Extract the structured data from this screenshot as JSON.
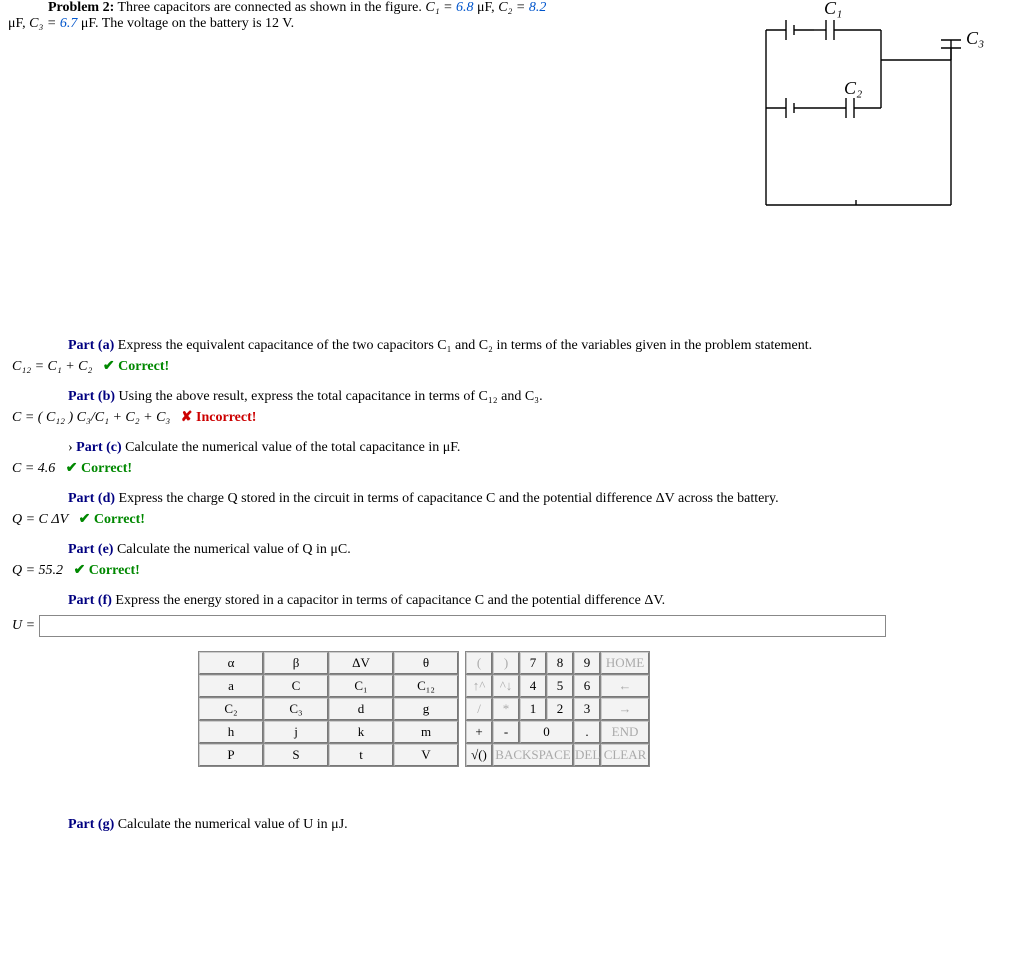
{
  "problem": {
    "label": "Problem 2:",
    "text_prefix": "Three capacitors are connected as shown in the figure. ",
    "c1_sym": "C₁ = ",
    "c1_val": "6.8",
    "c1_unit": " μF, ",
    "c2_sym": "C₂ = ",
    "c2_val": "8.2",
    "line2_prefix": "μF, ",
    "c3_sym": "C₃ = ",
    "c3_val": "6.7",
    "c3_unit": " μF. The voltage on the battery is 12 V."
  },
  "circuit": {
    "c1": "C₁",
    "c2": "C₂",
    "c3": "C₃"
  },
  "parts": {
    "a": {
      "label": "Part (a)",
      "text": "Express the equivalent capacitance of the two capacitors C₁ and C₂ in terms of the variables given in the problem statement.",
      "answer": "C₁₂ = C₁ + C₂",
      "status": "✔ Correct!"
    },
    "b": {
      "label": "Part (b)",
      "text": "Using the above result, express the total capacitance in terms of C₁₂ and C₃.",
      "answer": "C = ( C₁₂ ) C₃/C₁ + C₂ + C₃",
      "status": "✘ Incorrect!"
    },
    "c": {
      "label": "Part (c)",
      "marker": "›",
      "text": "Calculate the numerical value of the total capacitance in μF.",
      "answer": "C = 4.6",
      "status": "✔ Correct!"
    },
    "d": {
      "label": "Part (d)",
      "text": "Express the charge Q stored in the circuit in terms of capacitance C and the potential difference ΔV across the battery.",
      "answer": "Q = C ΔV",
      "status": "✔ Correct!"
    },
    "e": {
      "label": "Part (e)",
      "text": "Calculate the numerical value of Q in μC.",
      "answer": "Q = 55.2",
      "status": "✔ Correct!"
    },
    "f": {
      "label": "Part (f)",
      "text": "Express the energy stored in a capacitor in terms of capacitance C and the potential difference ΔV.",
      "input_label": "U ="
    },
    "g": {
      "label": "Part (g)",
      "text": "Calculate the numerical value of U in μJ."
    }
  },
  "keypad": {
    "vars": [
      [
        "α",
        "β",
        "ΔV",
        "θ"
      ],
      [
        "a",
        "C",
        "C₁",
        "C₁₂"
      ],
      [
        "C₂",
        "C₃",
        "d",
        "g"
      ],
      [
        "h",
        "j",
        "k",
        "m"
      ],
      [
        "P",
        "S",
        "t",
        "V"
      ]
    ],
    "nums_rows": [
      [
        "(",
        ")",
        "7",
        "8",
        "9",
        "HOME"
      ],
      [
        "↑^",
        "^↓",
        "4",
        "5",
        "6",
        "←"
      ],
      [
        "/",
        "*",
        "1",
        "2",
        "3",
        "→"
      ],
      [
        "+",
        "-",
        "0",
        "0",
        ".",
        "END"
      ]
    ],
    "bottom": {
      "sqrt": "√()",
      "backspace": "BACKSPACE",
      "del": "DEL",
      "clear": "CLEAR"
    }
  }
}
